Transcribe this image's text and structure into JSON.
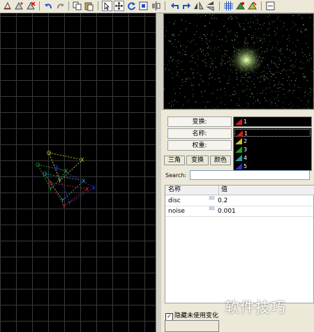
{
  "toolbar": {
    "icons": [
      "new-flame-icon",
      "transform-icon",
      "delete-transform-icon",
      "undo-icon",
      "redo-icon",
      "copy-icon",
      "paste-icon",
      "select-tool-icon",
      "move-tool-icon",
      "rotate-tool-icon",
      "scale-tool-icon",
      "flip-tool-icon",
      "rotate-left-icon",
      "rotate-right-icon",
      "flip-horizontal-icon",
      "flip-vertical-icon",
      "grid-icon",
      "pivot-icon",
      "reset-icon",
      "options-icon"
    ]
  },
  "transform_panel": {
    "transform_label": "变换:",
    "name_label": "名称:",
    "weight_label": "权重:",
    "selected_transform": "1",
    "transform_options": [
      {
        "label": "1",
        "color": "#cc2020"
      },
      {
        "label": "2",
        "color": "#c8c020"
      },
      {
        "label": "3",
        "color": "#20a020"
      },
      {
        "label": "4",
        "color": "#20a0a0"
      },
      {
        "label": "5",
        "color": "#3030c0"
      }
    ]
  },
  "tabs": [
    "三角",
    "变换",
    "颜色"
  ],
  "search": {
    "label": "Search:",
    "value": ""
  },
  "variations": {
    "headers": [
      "名称",
      "值"
    ],
    "rows": [
      {
        "name": "disc",
        "marker": "3D",
        "value": "0.2"
      },
      {
        "name": "noise",
        "marker": "3D",
        "value": "0.001"
      }
    ]
  },
  "hide_unused": {
    "label": "隐藏未使用变化",
    "checked": true
  },
  "watermark": "软件技巧",
  "colors": {
    "editor_bg": "#000000",
    "grid": "#3a3a3a",
    "panel_bg": "#ece9d8"
  }
}
